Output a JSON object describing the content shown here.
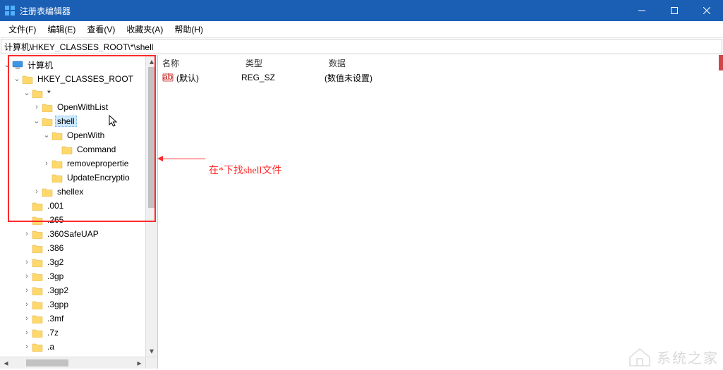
{
  "window": {
    "title": "注册表编辑器"
  },
  "menu": {
    "file": "文件(F)",
    "edit": "编辑(E)",
    "view": "查看(V)",
    "favorites": "收藏夹(A)",
    "help": "帮助(H)"
  },
  "address": {
    "value": "计算机\\HKEY_CLASSES_ROOT\\*\\shell"
  },
  "tree": {
    "root": "计算机",
    "hkcr": "HKEY_CLASSES_ROOT",
    "star": "*",
    "openwithlist": "OpenWithList",
    "shell": "shell",
    "openwith": "OpenWith",
    "command": "Command",
    "removeproperties": "removepropertie",
    "updateencryption": "UpdateEncryptio",
    "shellex": "shellex",
    "ext_001": ".001",
    "ext_265": ".265",
    "ext_360safeuap": ".360SafeUAP",
    "ext_386": ".386",
    "ext_3g2": ".3g2",
    "ext_3gp": ".3gp",
    "ext_3gp2": ".3gp2",
    "ext_3gpp": ".3gpp",
    "ext_3mf": ".3mf",
    "ext_7z": ".7z",
    "ext_a": ".a"
  },
  "list": {
    "header_name": "名称",
    "header_type": "类型",
    "header_data": "数据",
    "row0_name": "(默认)",
    "row0_type": "REG_SZ",
    "row0_data": "(数值未设置)"
  },
  "annotation": {
    "text": "在*下找shell文件"
  },
  "watermark_text": "系统之家"
}
